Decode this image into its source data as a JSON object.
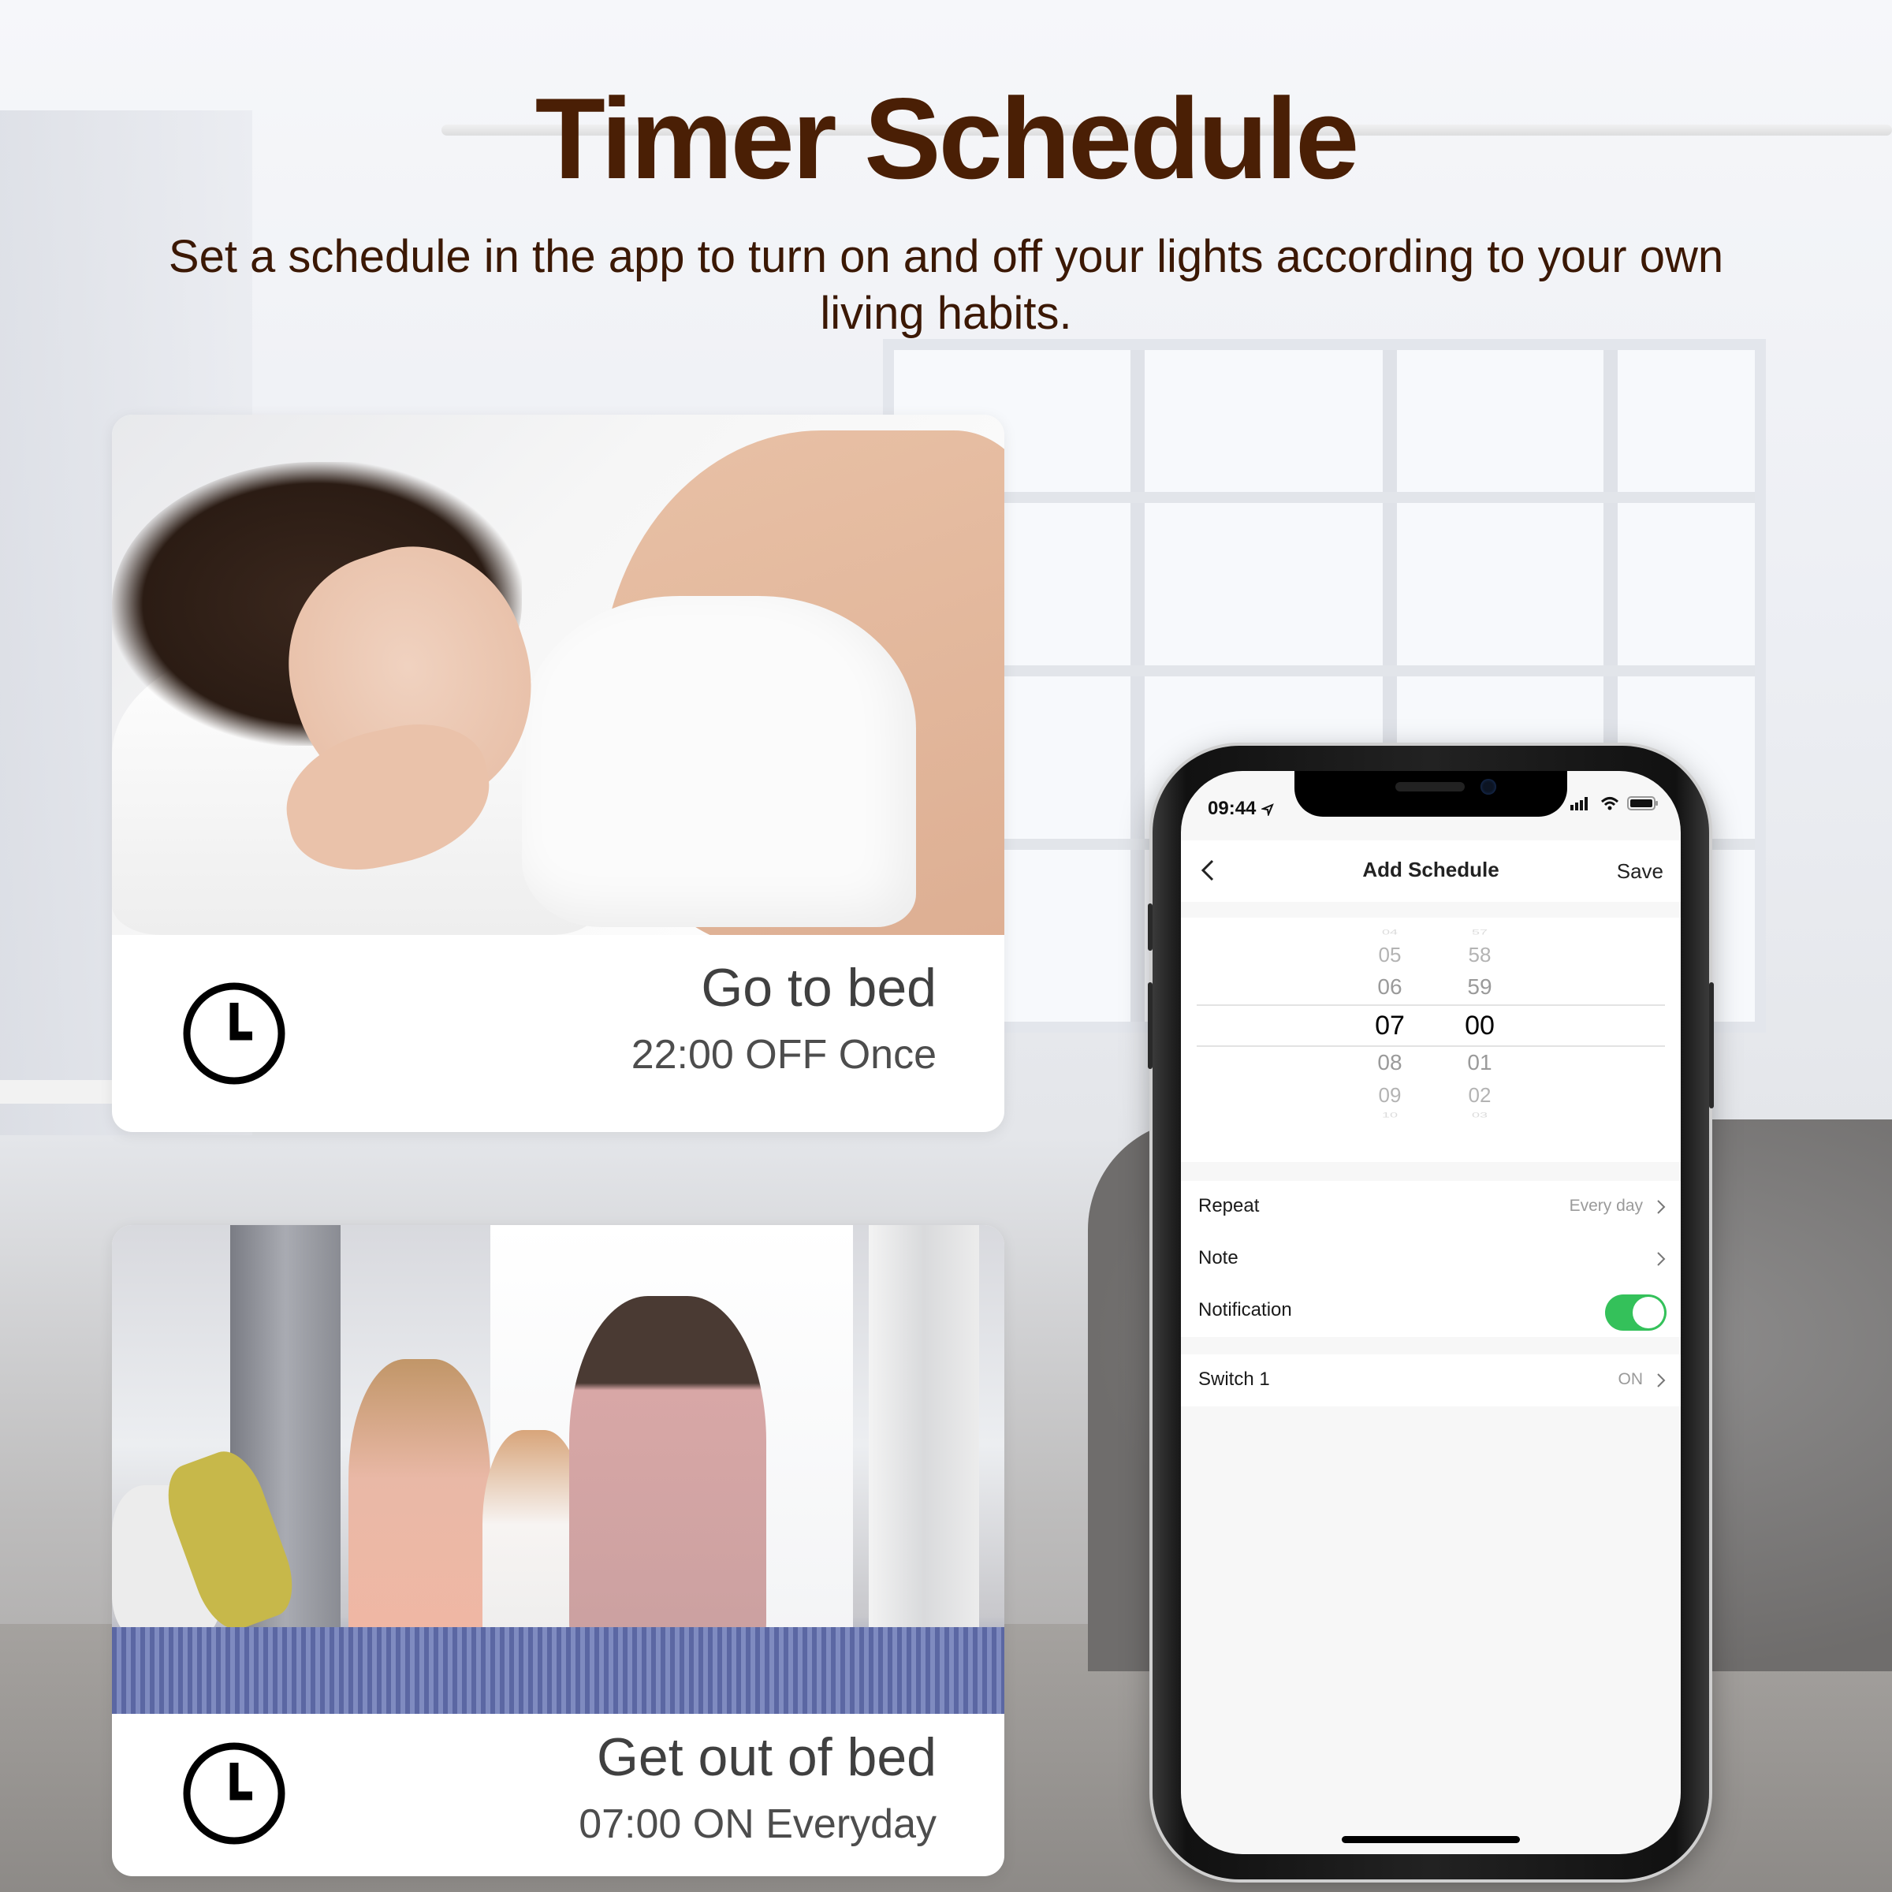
{
  "header": {
    "title": "Timer Schedule",
    "subtitle": "Set a schedule in the app to turn on and off your lights according to your own living habits."
  },
  "colors": {
    "title": "#4a1f05",
    "subtitle": "#3b1804",
    "toggle_on": "#34c15a"
  },
  "cards": [
    {
      "photo": "woman-sleeping-in-white-bed",
      "icon": "clock-icon",
      "title": "Go to bed",
      "detail": "22:00 OFF Once"
    },
    {
      "photo": "family-stretching-on-bed-by-window",
      "icon": "clock-icon",
      "title": "Get out of bed",
      "detail": "07:00 ON Everyday"
    }
  ],
  "phone": {
    "status_bar": {
      "time": "09:44",
      "icons": [
        "location-arrow-icon",
        "signal-icon",
        "wifi-icon",
        "battery-icon"
      ]
    },
    "nav": {
      "back_icon": "chevron-left-icon",
      "title": "Add Schedule",
      "save_label": "Save"
    },
    "time_picker": {
      "hours": [
        "04",
        "05",
        "06",
        "07",
        "08",
        "09",
        "10"
      ],
      "minutes": [
        "57",
        "58",
        "59",
        "00",
        "01",
        "02",
        "03"
      ],
      "selected_hour": "07",
      "selected_minute": "00"
    },
    "settings": [
      {
        "label": "Repeat",
        "value": "Every day",
        "control": "chevron"
      },
      {
        "label": "Note",
        "value": "",
        "control": "chevron"
      },
      {
        "label": "Notification",
        "value": "",
        "control": "toggle",
        "toggle_on": true
      }
    ],
    "switch_row": {
      "label": "Switch 1",
      "value": "ON",
      "control": "chevron"
    }
  }
}
